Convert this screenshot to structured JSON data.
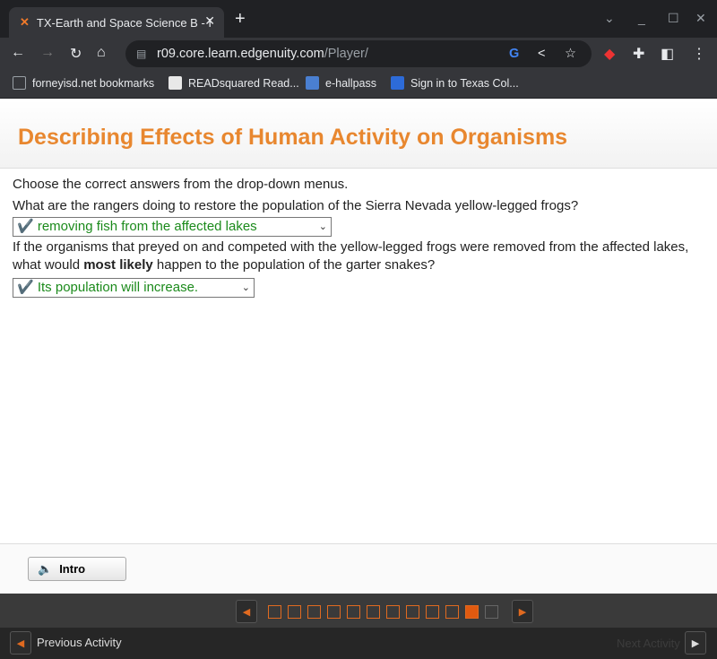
{
  "browser": {
    "tab_title": "TX-Earth and Space Science B - I",
    "url_host": "r09.core.learn.edgenuity.com",
    "url_path": "/Player/",
    "bookmarks": [
      {
        "label": "forneyisd.net bookmarks",
        "color": "#9aa0a6"
      },
      {
        "label": "READsquared Read...",
        "color": "#e8e8e8"
      },
      {
        "label": "e-hallpass",
        "color": "#4a7fd1"
      },
      {
        "label": "Sign in to Texas Col...",
        "color": "#2d6bd8"
      }
    ]
  },
  "page": {
    "title": "Describing Effects of Human Activity on Organisms",
    "accent": "#e8872f",
    "instruction": "Choose the correct answers from the drop-down menus.",
    "q1": "What are the rangers doing to restore the population of the Sierra Nevada yellow-legged frogs?",
    "a1": "✔️ removing fish from the affected lakes",
    "q2_line1": "If the organisms that preyed on and competed with the yellow-legged frogs were removed from the affected lakes,",
    "q2_pre": "what would ",
    "q2_bold": "most likely",
    "q2_post": " happen to the population of the garter snakes?",
    "a2": "✔️ Its population will increase."
  },
  "footer": {
    "intro_label": "Intro"
  },
  "nav": {
    "total_pages": 12,
    "current_page": 11,
    "previous_label": "Previous Activity",
    "next_label": "Next Activity"
  }
}
